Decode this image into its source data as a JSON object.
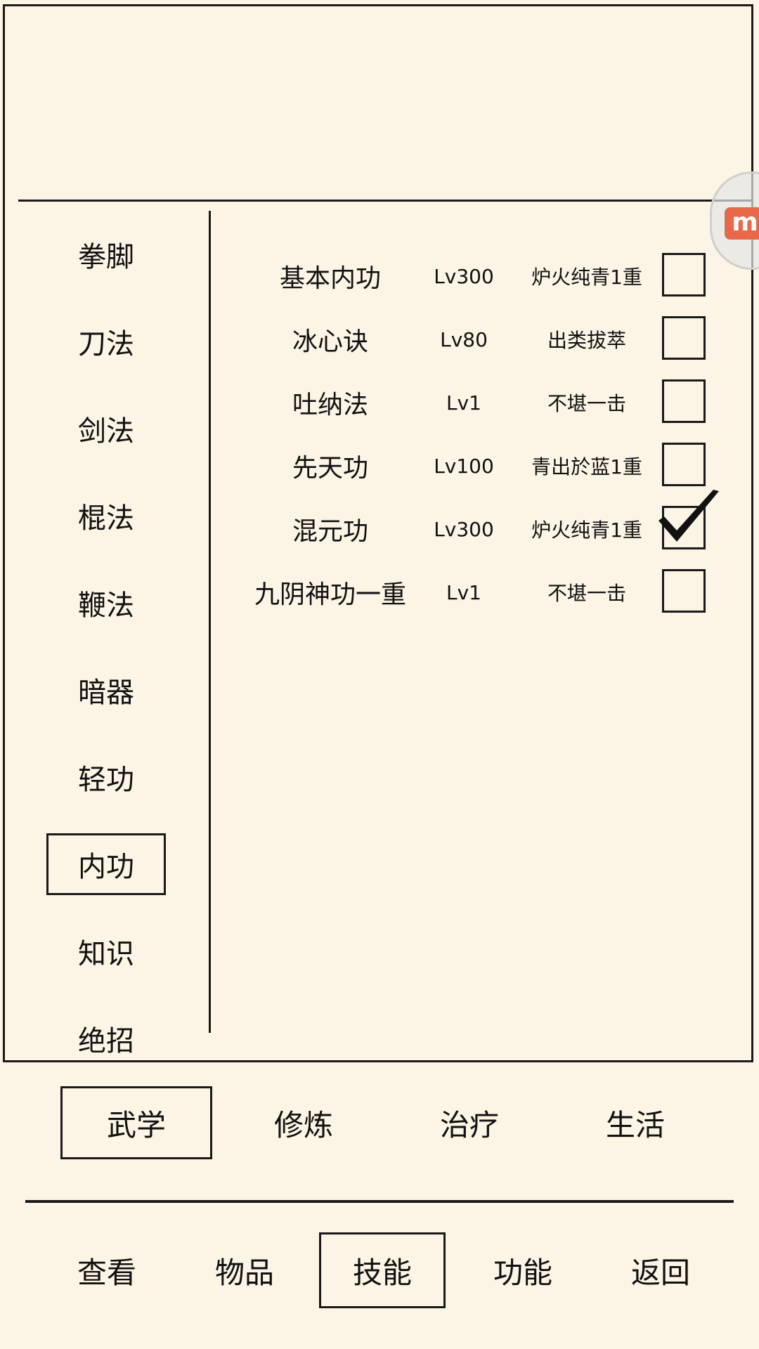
{
  "categories": [
    "拳脚",
    "刀法",
    "剑法",
    "棍法",
    "鞭法",
    "暗器",
    "轻功",
    "内功",
    "知识",
    "绝招"
  ],
  "active_category": "内功",
  "skills": [
    {
      "name": "基本内功",
      "level": "Lv300",
      "rank": "炉火纯青1重",
      "checked": false
    },
    {
      "name": "冰心诀",
      "level": "Lv80",
      "rank": "出类拔萃",
      "checked": false
    },
    {
      "name": "吐纳法",
      "level": "Lv1",
      "rank": "不堪一击",
      "checked": false
    },
    {
      "name": "先天功",
      "level": "Lv100",
      "rank": "青出於蓝1重",
      "checked": false
    },
    {
      "name": "混元功",
      "level": "Lv300",
      "rank": "炉火纯青1重",
      "checked": true
    },
    {
      "name": "九阴神功一重",
      "level": "Lv1",
      "rank": "不堪一击",
      "checked": false
    }
  ],
  "sub_tabs": [
    "武学",
    "修炼",
    "治疗",
    "生活"
  ],
  "active_sub_tab": "武学",
  "nav_tabs": [
    "查看",
    "物品",
    "技能",
    "功能",
    "返回"
  ],
  "active_nav_tab": "技能",
  "float_button": {
    "icon": "m-logo-icon",
    "color": "#e8694a"
  }
}
